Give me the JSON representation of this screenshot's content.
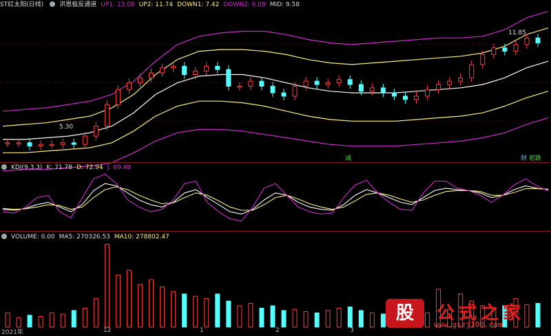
{
  "colors": {
    "bg": "#000000",
    "up": "#ff4040",
    "down": "#54ffff",
    "yellow": "#fff07a",
    "magenta": "#d02bd0",
    "white": "#ffffff",
    "sep": "#8b1a1a"
  },
  "main": {
    "title": "ST红太阳(日线)",
    "indicator": "洪恩极反通道",
    "up1": "UP1: 13.08",
    "up2": "UP2: 11.74",
    "down1": "DOWN1: 7.42",
    "down2": "DOWN2: 6.08",
    "mid": "MID: 9.58",
    "high_label": "11.85",
    "low_label": "5.30",
    "signal1": "减",
    "signal2": "财",
    "signal3": "初跌"
  },
  "kdj": {
    "title": "KDJ(9,3,3)",
    "k": "K: 71.78",
    "d": "D: 72.94",
    "j": "J: 69.48"
  },
  "vol": {
    "title": "VOLUME: 0.00",
    "ma5": "MA5: 270326.53",
    "ma10": "MA10: 278802.47"
  },
  "dates": {
    "d1": "2021年",
    "d2": "12",
    "d3": "1",
    "d4": "2",
    "d5": "3"
  },
  "watermark": {
    "logo": "股",
    "title": "公式之家",
    "url": "www.gszj100.com"
  },
  "chart_data": [
    {
      "type": "candlestick",
      "title": "ST红太阳(日线)",
      "ylim": [
        4.5,
        13.5
      ],
      "series": [
        {
          "name": "UP1",
          "values": [
            7.4,
            7.5,
            7.6,
            7.8,
            8.0,
            8.4,
            9.2,
            10.4,
            11.4,
            11.9,
            12.1,
            12.2,
            12.2,
            12.0,
            11.7,
            11.5,
            11.4,
            11.5,
            11.6,
            11.7,
            11.8,
            11.8,
            11.9,
            12.3,
            13.0,
            13.4
          ]
        },
        {
          "name": "UP2",
          "values": [
            6.5,
            6.6,
            6.7,
            6.9,
            7.1,
            7.6,
            8.4,
            9.6,
            10.5,
            11.0,
            11.1,
            11.1,
            11.0,
            10.8,
            10.5,
            10.3,
            10.2,
            10.3,
            10.4,
            10.5,
            10.6,
            10.7,
            10.9,
            11.3,
            12.0,
            12.4
          ]
        },
        {
          "name": "MID",
          "values": [
            5.7,
            5.7,
            5.8,
            5.9,
            6.1,
            6.5,
            7.3,
            8.4,
            9.1,
            9.5,
            9.6,
            9.6,
            9.4,
            9.1,
            8.8,
            8.6,
            8.5,
            8.5,
            8.5,
            8.6,
            8.7,
            8.8,
            9.0,
            9.4,
            10.0,
            10.4
          ]
        },
        {
          "name": "DOWN1",
          "values": [
            4.9,
            4.9,
            5.0,
            5.1,
            5.2,
            5.5,
            6.2,
            7.1,
            7.7,
            8.0,
            8.0,
            7.9,
            7.7,
            7.4,
            7.1,
            6.9,
            6.8,
            6.8,
            6.8,
            6.9,
            7.0,
            7.1,
            7.3,
            7.7,
            8.2,
            8.6
          ]
        },
        {
          "name": "DOWN2",
          "values": [
            3.8,
            3.9,
            3.9,
            4.0,
            4.1,
            4.3,
            4.9,
            5.6,
            6.1,
            6.3,
            6.3,
            6.2,
            6.0,
            5.8,
            5.6,
            5.4,
            5.3,
            5.3,
            5.3,
            5.4,
            5.5,
            5.6,
            5.8,
            6.1,
            6.6,
            7.0
          ]
        }
      ],
      "closes": [
        5.5,
        5.5,
        5.3,
        5.4,
        5.4,
        5.5,
        5.4,
        5.9,
        6.5,
        7.8,
        8.7,
        9.1,
        9.4,
        9.7,
        10.0,
        10.1,
        9.6,
        9.8,
        10.1,
        9.9,
        8.9,
        8.9,
        9.2,
        8.9,
        8.5,
        8.3,
        8.9,
        9.2,
        9.0,
        9.1,
        9.3,
        9.0,
        8.6,
        8.8,
        8.5,
        8.3,
        8.1,
        8.3,
        8.7,
        9.0,
        9.2,
        9.4,
        10.2,
        10.8,
        11.2,
        11.0,
        11.4,
        11.8,
        11.5
      ]
    },
    {
      "type": "line",
      "title": "KDJ(9,3,3)",
      "ylim": [
        -10,
        110
      ],
      "series": [
        {
          "name": "K",
          "values": [
            30,
            28,
            32,
            40,
            45,
            35,
            25,
            40,
            70,
            85,
            80,
            65,
            50,
            40,
            35,
            45,
            65,
            72,
            55,
            40,
            25,
            20,
            30,
            50,
            65,
            60,
            45,
            35,
            30,
            28,
            40,
            60,
            72,
            65,
            55,
            45,
            40,
            55,
            70,
            75,
            72,
            70,
            65,
            55,
            60,
            72,
            80,
            75,
            72
          ]
        },
        {
          "name": "D",
          "values": [
            32,
            30,
            31,
            35,
            40,
            38,
            30,
            35,
            55,
            72,
            78,
            72,
            60,
            50,
            42,
            44,
            55,
            65,
            60,
            48,
            35,
            28,
            28,
            40,
            55,
            60,
            52,
            42,
            35,
            30,
            35,
            48,
            62,
            65,
            60,
            52,
            45,
            50,
            60,
            68,
            70,
            70,
            68,
            60,
            60,
            66,
            74,
            74,
            73
          ]
        },
        {
          "name": "J",
          "values": [
            25,
            22,
            35,
            55,
            60,
            25,
            12,
            55,
            95,
            105,
            85,
            50,
            35,
            25,
            30,
            50,
            85,
            90,
            45,
            25,
            10,
            5,
            35,
            75,
            85,
            60,
            35,
            25,
            20,
            22,
            55,
            82,
            92,
            65,
            45,
            30,
            28,
            65,
            90,
            90,
            75,
            70,
            60,
            45,
            60,
            82,
            95,
            80,
            69
          ]
        }
      ]
    },
    {
      "type": "bar",
      "title": "VOLUME",
      "values": [
        60,
        40,
        50,
        45,
        60,
        55,
        70,
        80,
        120,
        350,
        220,
        240,
        180,
        200,
        170,
        150,
        140,
        130,
        120,
        140,
        110,
        90,
        100,
        80,
        90,
        70,
        75,
        65,
        60,
        70,
        80,
        85,
        70,
        60,
        55,
        50,
        45,
        55,
        60,
        160,
        75,
        140,
        110,
        90,
        80,
        90,
        120,
        95,
        100
      ]
    }
  ]
}
